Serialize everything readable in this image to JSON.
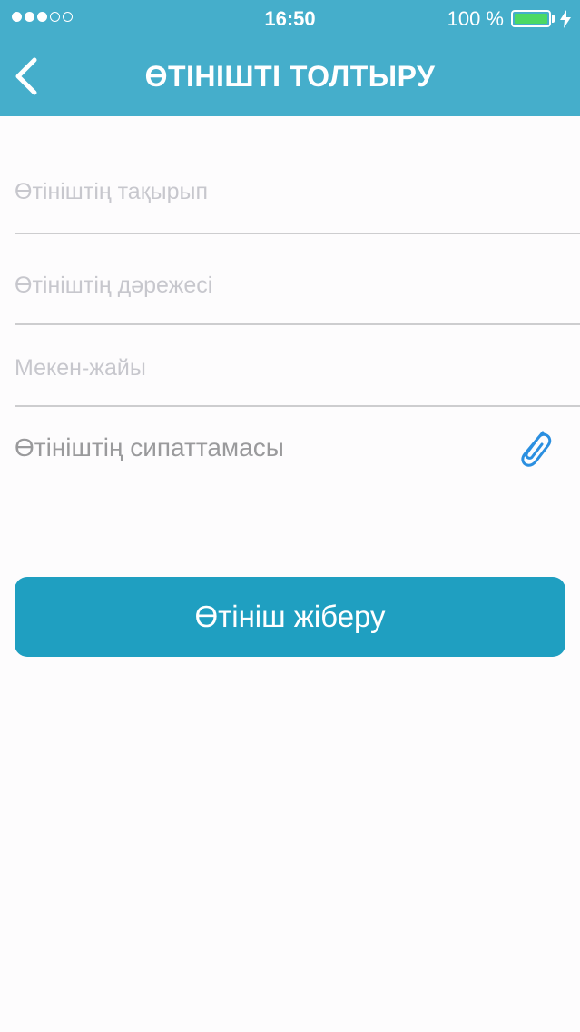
{
  "status_bar": {
    "time": "16:50",
    "battery_percent_text": "100 %",
    "battery_level": 1.0,
    "signal_bars_filled": 3,
    "signal_bars_total": 5,
    "battery_color": "#4cd964"
  },
  "header": {
    "title": "ӨТІНІШТІ ТОЛТЫРУ",
    "back_icon": "chevron-left-icon",
    "background_color": "#45aecb"
  },
  "form": {
    "subject": {
      "value": "",
      "placeholder": "Өтініштің тақырып"
    },
    "priority": {
      "value": "",
      "placeholder": "Өтініштің дәрежесі"
    },
    "address": {
      "value": "",
      "placeholder": "Мекен-жайы"
    },
    "description": {
      "value": "",
      "placeholder": "Өтініштің сипаттамасы"
    },
    "attach_icon": "paperclip-icon",
    "accent_color": "#1f9fc1"
  },
  "submit_button": {
    "label": "Өтініш жіберу"
  }
}
